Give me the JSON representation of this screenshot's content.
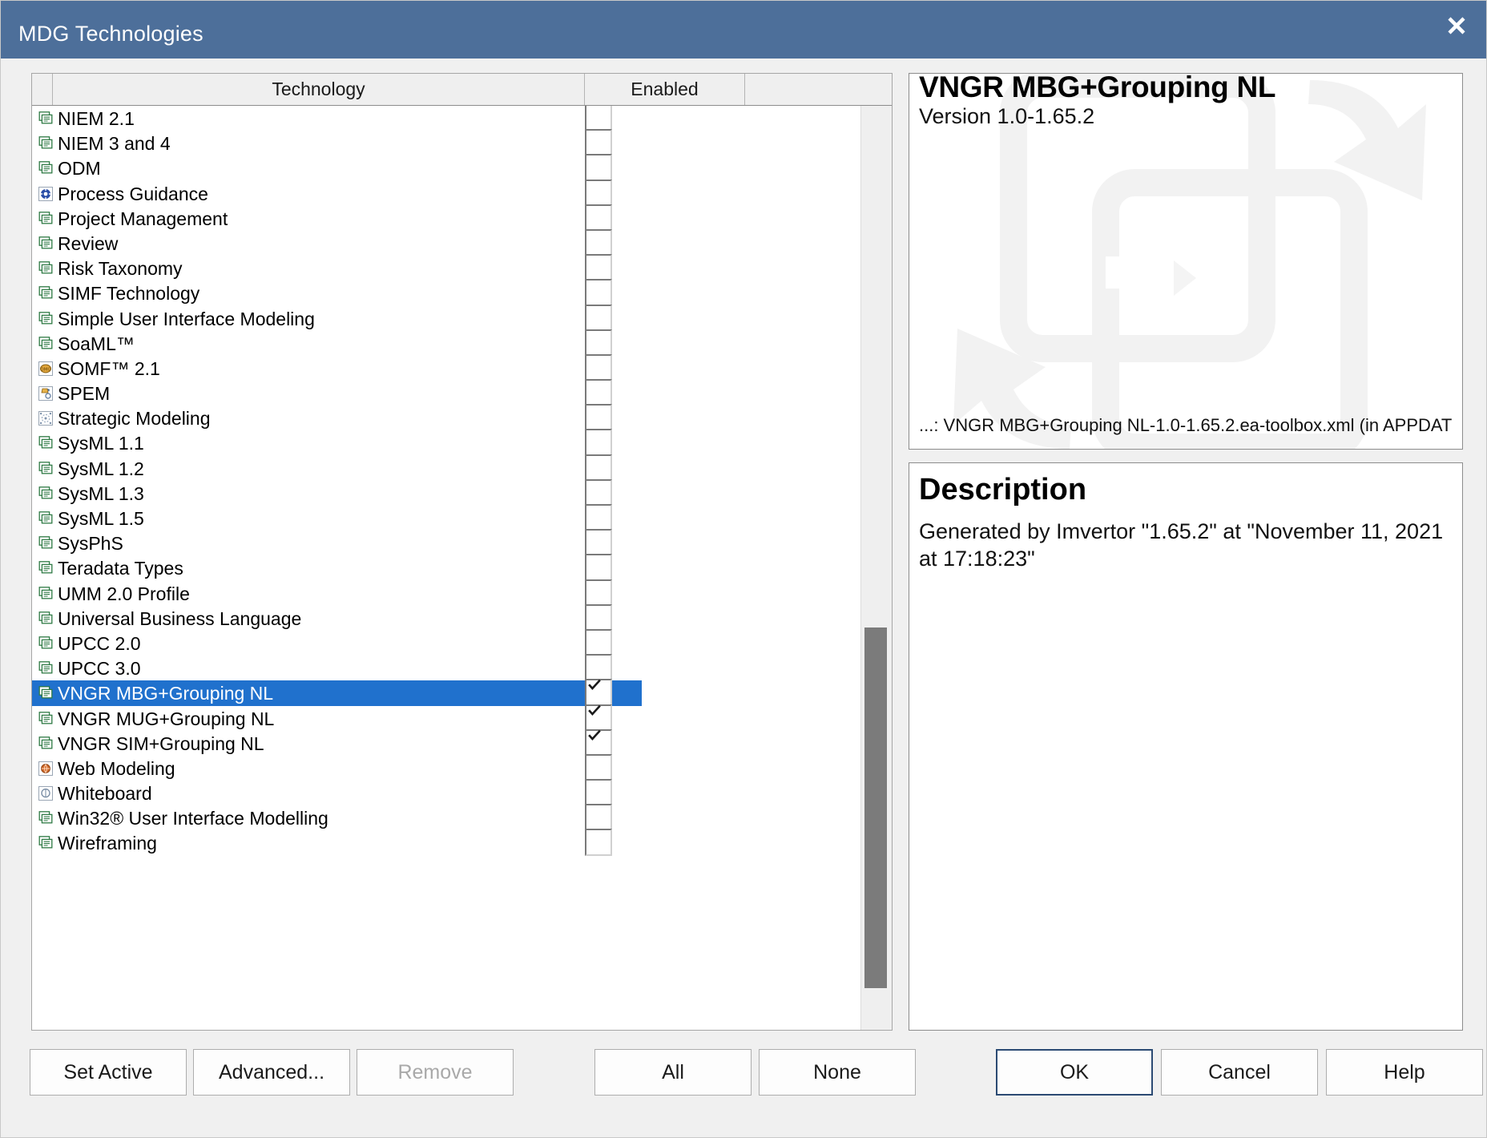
{
  "window": {
    "title": "MDG Technologies",
    "close_label": "✕",
    "accent_color": "#4d6f9a",
    "selection_color": "#2071cd"
  },
  "list": {
    "columns": [
      "",
      "Technology",
      "Enabled",
      ""
    ],
    "rows": [
      {
        "label": "NIEM 2.1",
        "icon": "mdg-profile-icon",
        "enabled": false,
        "selected": false
      },
      {
        "label": "NIEM 3 and 4",
        "icon": "mdg-profile-icon",
        "enabled": false,
        "selected": false
      },
      {
        "label": "ODM",
        "icon": "mdg-profile-icon",
        "enabled": false,
        "selected": false
      },
      {
        "label": "Process Guidance",
        "icon": "process-guidance-icon",
        "enabled": false,
        "selected": false
      },
      {
        "label": "Project Management",
        "icon": "mdg-profile-icon",
        "enabled": false,
        "selected": false
      },
      {
        "label": "Review",
        "icon": "mdg-profile-icon",
        "enabled": false,
        "selected": false
      },
      {
        "label": "Risk Taxonomy",
        "icon": "mdg-profile-icon",
        "enabled": false,
        "selected": false
      },
      {
        "label": "SIMF Technology",
        "icon": "mdg-profile-icon",
        "enabled": false,
        "selected": false
      },
      {
        "label": "Simple User Interface Modeling",
        "icon": "mdg-profile-icon",
        "enabled": false,
        "selected": false
      },
      {
        "label": "SoaML™",
        "icon": "mdg-profile-icon",
        "enabled": false,
        "selected": false
      },
      {
        "label": "SOMF™ 2.1",
        "icon": "somf-icon",
        "enabled": false,
        "selected": false
      },
      {
        "label": "SPEM",
        "icon": "spem-icon",
        "enabled": false,
        "selected": false
      },
      {
        "label": "Strategic Modeling",
        "icon": "strategic-modeling-icon",
        "enabled": false,
        "selected": false
      },
      {
        "label": "SysML 1.1",
        "icon": "mdg-profile-icon",
        "enabled": false,
        "selected": false
      },
      {
        "label": "SysML 1.2",
        "icon": "mdg-profile-icon",
        "enabled": false,
        "selected": false
      },
      {
        "label": "SysML 1.3",
        "icon": "mdg-profile-icon",
        "enabled": false,
        "selected": false
      },
      {
        "label": "SysML 1.5",
        "icon": "mdg-profile-icon",
        "enabled": false,
        "selected": false
      },
      {
        "label": "SysPhS",
        "icon": "mdg-profile-icon",
        "enabled": false,
        "selected": false
      },
      {
        "label": "Teradata Types",
        "icon": "mdg-profile-icon",
        "enabled": false,
        "selected": false
      },
      {
        "label": "UMM 2.0 Profile",
        "icon": "mdg-profile-icon",
        "enabled": false,
        "selected": false
      },
      {
        "label": "Universal Business Language",
        "icon": "mdg-profile-icon",
        "enabled": false,
        "selected": false
      },
      {
        "label": "UPCC 2.0",
        "icon": "mdg-profile-icon",
        "enabled": false,
        "selected": false
      },
      {
        "label": "UPCC 3.0",
        "icon": "mdg-profile-icon",
        "enabled": false,
        "selected": false
      },
      {
        "label": "VNGR MBG+Grouping NL",
        "icon": "mdg-profile-icon",
        "enabled": true,
        "selected": true
      },
      {
        "label": "VNGR MUG+Grouping NL",
        "icon": "mdg-profile-icon",
        "enabled": true,
        "selected": false
      },
      {
        "label": "VNGR SIM+Grouping NL",
        "icon": "mdg-profile-icon",
        "enabled": true,
        "selected": false
      },
      {
        "label": "Web Modeling",
        "icon": "web-modeling-icon",
        "enabled": false,
        "selected": false
      },
      {
        "label": "Whiteboard",
        "icon": "whiteboard-icon",
        "enabled": false,
        "selected": false
      },
      {
        "label": "Win32® User Interface Modelling",
        "icon": "mdg-profile-icon",
        "enabled": false,
        "selected": false
      },
      {
        "label": "Wireframing",
        "icon": "mdg-profile-icon",
        "enabled": false,
        "selected": false
      }
    ]
  },
  "info": {
    "title": "VNGR MBG+Grouping NL",
    "version": "Version 1.0-1.65.2",
    "path": "...: VNGR MBG+Grouping NL-1.0-1.65.2.ea-toolbox.xml (in APPDAT"
  },
  "description": {
    "heading": "Description",
    "text": "Generated by Imvertor \"1.65.2\" at \"November 11, 2021 at 17:18:23\""
  },
  "buttons": {
    "set_active": "Set Active",
    "advanced": "Advanced...",
    "remove": "Remove",
    "all": "All",
    "none": "None",
    "ok": "OK",
    "cancel": "Cancel",
    "help": "Help"
  }
}
